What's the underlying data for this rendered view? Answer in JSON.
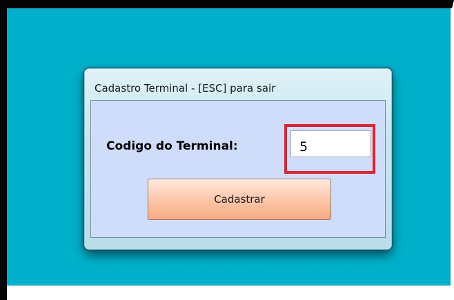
{
  "window": {
    "title": "Cadastro Terminal - [ESC] para sair"
  },
  "form": {
    "terminal_label": "Codigo do Terminal:",
    "terminal_value": "5",
    "submit_label": "Cadastrar"
  },
  "colors": {
    "desktop": "#00b0cb",
    "client_area": "#cfddfb",
    "highlight": "#e3202b",
    "button": "#fccbb0"
  }
}
